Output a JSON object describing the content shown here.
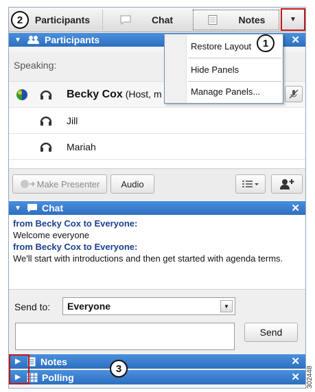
{
  "tabs": {
    "participants": "Participants",
    "chat": "Chat",
    "notes": "Notes"
  },
  "callouts": [
    "1",
    "2",
    "3"
  ],
  "participants_panel": {
    "title": "Participants",
    "speaking_label": "Speaking:",
    "people": [
      {
        "name": "Becky Cox",
        "role": "(Host, m",
        "icon": "headset-icon",
        "status_icon": "globe-icon"
      },
      {
        "name": "Jill",
        "icon": "headset-icon"
      },
      {
        "name": "Mariah",
        "icon": "headset-icon"
      }
    ],
    "buttons": {
      "make_presenter": "Make Presenter",
      "audio": "Audio"
    }
  },
  "panel_menu": {
    "items": [
      "Restore Layout",
      "Hide Panels",
      "Manage Panels..."
    ]
  },
  "chat_panel": {
    "title": "Chat",
    "messages": [
      {
        "from": "from Becky Cox to Everyone:",
        "text": "Welcome everyone"
      },
      {
        "from": "from Becky Cox to Everyone:",
        "text": "We'll start with introductions and then get started with agenda terms."
      }
    ],
    "send_to_label": "Send to:",
    "recipient": "Everyone",
    "send_button": "Send",
    "message_value": ""
  },
  "collapsed_panels": {
    "notes": "Notes",
    "polling": "Polling"
  },
  "figure_id": "302448",
  "colors": {
    "panel_header": "#2e6fc0",
    "callout_highlight": "#c01818",
    "chat_sender": "#1a3f8f"
  }
}
